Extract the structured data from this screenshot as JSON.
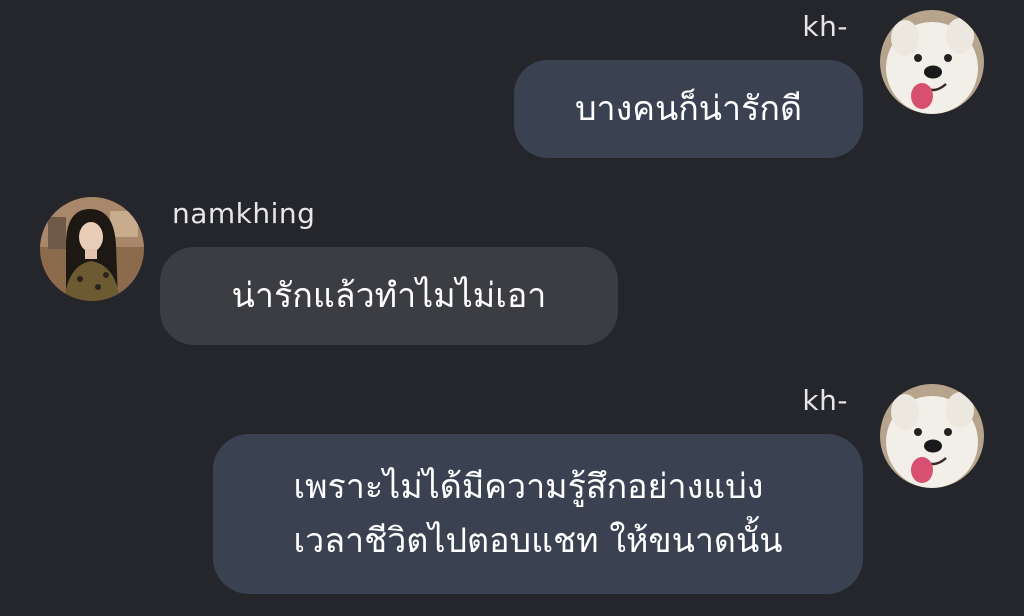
{
  "messages": [
    {
      "sender": "kh-",
      "direction": "sent",
      "avatar_icon": "samoyed-dog-avatar-icon",
      "lines": [
        "บางคนก็น่ารักดี"
      ]
    },
    {
      "sender": "namkhing",
      "direction": "received",
      "avatar_icon": "woman-portrait-avatar-icon",
      "lines": [
        "น่ารักแล้วทำไมไม่เอา"
      ]
    },
    {
      "sender": "kh-",
      "direction": "sent",
      "avatar_icon": "samoyed-dog-avatar-icon",
      "lines": [
        "เพราะไม่ได้มีความรู้สึกอย่างแบ่ง",
        "เวลาชีวิตไปตอบแชท ให้ขนาดนั้น"
      ]
    }
  ],
  "colors": {
    "background": "#25262b",
    "sent_bubble": "#3a4252",
    "received_bubble": "#3c3d42",
    "text": "#ffffff"
  }
}
